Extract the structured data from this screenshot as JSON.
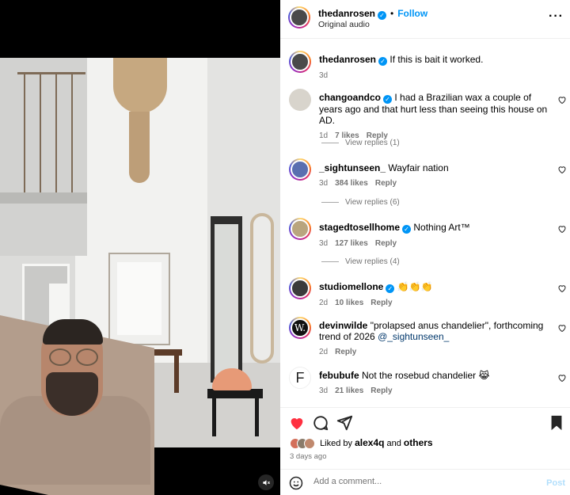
{
  "post": {
    "author": "thedanrosen",
    "follow_label": "Follow",
    "separator": "•",
    "audio": "Original audio",
    "caption": "If this is bait it worked.",
    "caption_age": "3d"
  },
  "comments": [
    {
      "user": "changoandco",
      "verified": true,
      "text": "I had a Brazilian wax a couple of years ago and that hurt less than seeing this house on AD.",
      "age": "1d",
      "likes": "7 likes",
      "reply": "Reply",
      "view_replies": "View replies (1)"
    },
    {
      "user": "_sightunseen_",
      "verified": false,
      "text": "Wayfair nation",
      "age": "3d",
      "likes": "384 likes",
      "reply": "Reply",
      "view_replies": "View replies (6)"
    },
    {
      "user": "stagedtosellhome",
      "verified": true,
      "text": "Nothing Art™",
      "age": "3d",
      "likes": "127 likes",
      "reply": "Reply",
      "view_replies": "View replies (4)"
    },
    {
      "user": "studiomellone",
      "verified": true,
      "text": "👏👏👏",
      "age": "2d",
      "likes": "10 likes",
      "reply": "Reply"
    },
    {
      "user": "devinwilde",
      "verified": false,
      "text": "\"prolapsed anus chandelier\", forthcoming trend of 2026 ",
      "mention": "@_sightunseen_",
      "age": "2d",
      "reply": "Reply"
    },
    {
      "user": "febubufe",
      "verified": false,
      "text": "Not the rosebud chandelier 😹",
      "age": "3d",
      "likes": "21 likes",
      "reply": "Reply",
      "avatar_letter": "F"
    }
  ],
  "likes": {
    "prefix": "Liked by ",
    "user": "alex4q",
    "middle": " and ",
    "others": "others",
    "posted": "3 days ago"
  },
  "composer": {
    "placeholder": "Add a comment...",
    "post_label": "Post"
  },
  "icons": {
    "more": "more-options-icon",
    "verified": "verified-badge-icon",
    "heart": "heart-icon",
    "comment": "comment-icon",
    "share": "share-icon",
    "save": "bookmark-icon",
    "emoji": "emoji-icon",
    "mute": "muted-speaker-icon"
  },
  "colors": {
    "link": "#0095f6",
    "liked": "#ff3040",
    "muted_text": "#737373",
    "mention": "#00376b"
  }
}
